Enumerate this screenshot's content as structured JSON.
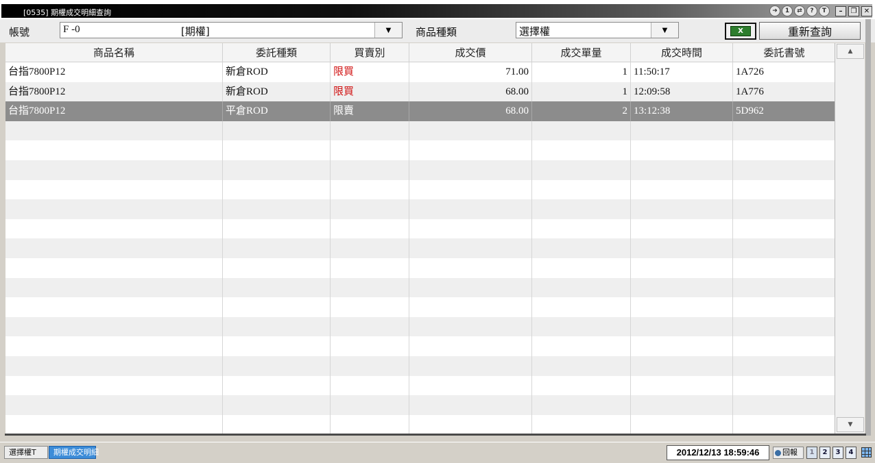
{
  "window": {
    "title": "[0535] 期權成交明細查詢",
    "title_icons": [
      "➜",
      "1",
      "⇄",
      "?",
      "T"
    ],
    "minimize": "–",
    "restore": "❐",
    "close": "✕"
  },
  "query": {
    "account_label": "帳號",
    "account_value": "F   -0",
    "account_type": "[期權]",
    "product_type_label": "商品種類",
    "product_type_value": "選擇權",
    "dropdown_arrow": "▼",
    "excel_label": "X",
    "requery_label": "重新查詢"
  },
  "grid": {
    "columns": [
      "商品名稱",
      "委託種類",
      "買賣別",
      "成交價",
      "成交單量",
      "成交時間",
      "委託書號"
    ],
    "rows": [
      {
        "product": "台指7800P12",
        "order_type": "新倉ROD",
        "side": "限買",
        "price": "71.00",
        "qty": "1",
        "time": "11:50:17",
        "order_no": "1A726"
      },
      {
        "product": "台指7800P12",
        "order_type": "新倉ROD",
        "side": "限買",
        "price": "68.00",
        "qty": "1",
        "time": "12:09:58",
        "order_no": "1A776"
      },
      {
        "product": "台指7800P12",
        "order_type": "平倉ROD",
        "side": "限賣",
        "price": "68.00",
        "qty": "2",
        "time": "13:12:38",
        "order_no": "5D962"
      }
    ]
  },
  "scrollbar": {
    "up": "▲",
    "down": "▼"
  },
  "status": {
    "tabs": [
      "選擇權T",
      "期權成交明細"
    ],
    "clock": "2012/12/13 18:59:46",
    "return_label": "回報",
    "mini_buttons": [
      "1",
      "2",
      "3",
      "4"
    ]
  },
  "colors": {
    "buy_side": "#d01010",
    "selected_row": "#8c8c8c",
    "active_tab": "#3c8cd8"
  }
}
